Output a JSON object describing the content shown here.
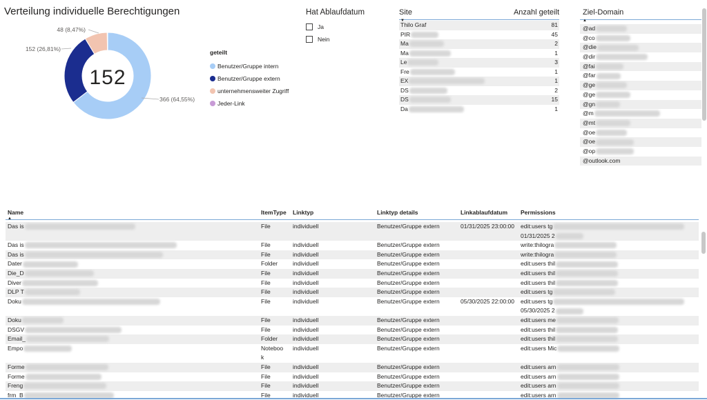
{
  "donut": {
    "title": "Verteilung individuelle Berechtigungen",
    "center_value": "152",
    "legend_title": "geteilt",
    "segments": [
      {
        "name": "Benutzer/Gruppe intern",
        "value": 366,
        "label": "366 (64,55%)",
        "color": "#a7cdf6"
      },
      {
        "name": "Benutzer/Gruppe extern",
        "value": 152,
        "label": "152 (26,81%)",
        "color": "#1b2d8f"
      },
      {
        "name": "unternehmensweiter Zugriff",
        "value": 48,
        "label": "48 (8,47%)",
        "color": "#f2c4b0"
      },
      {
        "name": "Jeder-Link",
        "value": 1,
        "label": "",
        "color": "#c89bd6"
      }
    ]
  },
  "slicer": {
    "title": "Hat Ablaufdatum",
    "options": [
      "Ja",
      "Nein"
    ]
  },
  "site_table": {
    "col_site": "Site",
    "col_count": "Anzahl geteilt",
    "rows": [
      {
        "site": "Thilo Graf",
        "count": "81"
      },
      {
        "site": "PIR",
        "count": "45"
      },
      {
        "site": "Ma",
        "count": "2"
      },
      {
        "site": "Ma",
        "count": "1"
      },
      {
        "site": "Le",
        "count": "3"
      },
      {
        "site": "Fre",
        "count": "1"
      },
      {
        "site": "EX",
        "count": "1"
      },
      {
        "site": "DS",
        "count": "2"
      },
      {
        "site": "DS",
        "count": "15"
      },
      {
        "site": "Da",
        "count": "1"
      }
    ]
  },
  "domain_table": {
    "col": "Ziel-Domain",
    "rows": [
      "@ad",
      "@co",
      "@die",
      "@dir",
      "@fai",
      "@far",
      "@ge",
      "@ge",
      "@gn",
      "@m",
      "@mt",
      "@oe",
      "@oe",
      "@op",
      "@outlook.com"
    ]
  },
  "main_table": {
    "columns": [
      "Name",
      "ItemType",
      "Linktyp",
      "Linktyp details",
      "Linkablaufdatum",
      "Permissions"
    ],
    "rows": [
      {
        "name": "Das is",
        "type": "File",
        "linktyp": "individuell",
        "details": "Benutzer/Gruppe extern",
        "ablauf": "01/31/2025 23:00:00",
        "perm": "edit:users tg",
        "perm2": "01/31/2025 2"
      },
      {
        "name": "Das is",
        "type": "File",
        "linktyp": "individuell",
        "details": "Benutzer/Gruppe extern",
        "ablauf": "",
        "perm": "write:thilogra",
        "perm2": ""
      },
      {
        "name": "Das is",
        "type": "File",
        "linktyp": "individuell",
        "details": "Benutzer/Gruppe extern",
        "ablauf": "",
        "perm": "write:thilogra",
        "perm2": ""
      },
      {
        "name": "Dater",
        "type": "Folder",
        "linktyp": "individuell",
        "details": "Benutzer/Gruppe extern",
        "ablauf": "",
        "perm": "edit:users thil",
        "perm2": ""
      },
      {
        "name": "Die_D",
        "type": "File",
        "linktyp": "individuell",
        "details": "Benutzer/Gruppe extern",
        "ablauf": "",
        "perm": "edit:users thil",
        "perm2": ""
      },
      {
        "name": "Diver",
        "type": "File",
        "linktyp": "individuell",
        "details": "Benutzer/Gruppe extern",
        "ablauf": "",
        "perm": "edit:users thil",
        "perm2": ""
      },
      {
        "name": "DLP T",
        "type": "File",
        "linktyp": "individuell",
        "details": "Benutzer/Gruppe extern",
        "ablauf": "",
        "perm": "edit:users tg",
        "perm2": ""
      },
      {
        "name": "Doku",
        "type": "File",
        "linktyp": "individuell",
        "details": "Benutzer/Gruppe extern",
        "ablauf": "05/30/2025 22:00:00",
        "perm": "edit:users tg",
        "perm2": "05/30/2025 2"
      },
      {
        "name": "Doku",
        "type": "File",
        "linktyp": "individuell",
        "details": "Benutzer/Gruppe extern",
        "ablauf": "",
        "perm": "edit:users me",
        "perm2": ""
      },
      {
        "name": "DSGV",
        "type": "File",
        "linktyp": "individuell",
        "details": "Benutzer/Gruppe extern",
        "ablauf": "",
        "perm": "edit:users thil",
        "perm2": ""
      },
      {
        "name": "Email_",
        "type": "Folder",
        "linktyp": "individuell",
        "details": "Benutzer/Gruppe extern",
        "ablauf": "",
        "perm": "edit:users thil",
        "perm2": ""
      },
      {
        "name": "Empo",
        "type": "Noteboo",
        "type2": "k",
        "linktyp": "individuell",
        "details": "Benutzer/Gruppe extern",
        "ablauf": "",
        "perm": "edit:users Mic",
        "perm2": ""
      },
      {
        "name": "Forme",
        "type": "File",
        "linktyp": "individuell",
        "details": "Benutzer/Gruppe extern",
        "ablauf": "",
        "perm": "edit:users arn",
        "perm2": ""
      },
      {
        "name": "Forme",
        "type": "File",
        "linktyp": "individuell",
        "details": "Benutzer/Gruppe extern",
        "ablauf": "",
        "perm": "edit:users arn",
        "perm2": ""
      },
      {
        "name": "Freng",
        "type": "File",
        "linktyp": "individuell",
        "details": "Benutzer/Gruppe extern",
        "ablauf": "",
        "perm": "edit:users arn",
        "perm2": ""
      },
      {
        "name": "frm_B",
        "type": "File",
        "linktyp": "individuell",
        "details": "Benutzer/Gruppe extern",
        "ablauf": "",
        "perm": "edit:users arn",
        "perm2": ""
      }
    ]
  }
}
